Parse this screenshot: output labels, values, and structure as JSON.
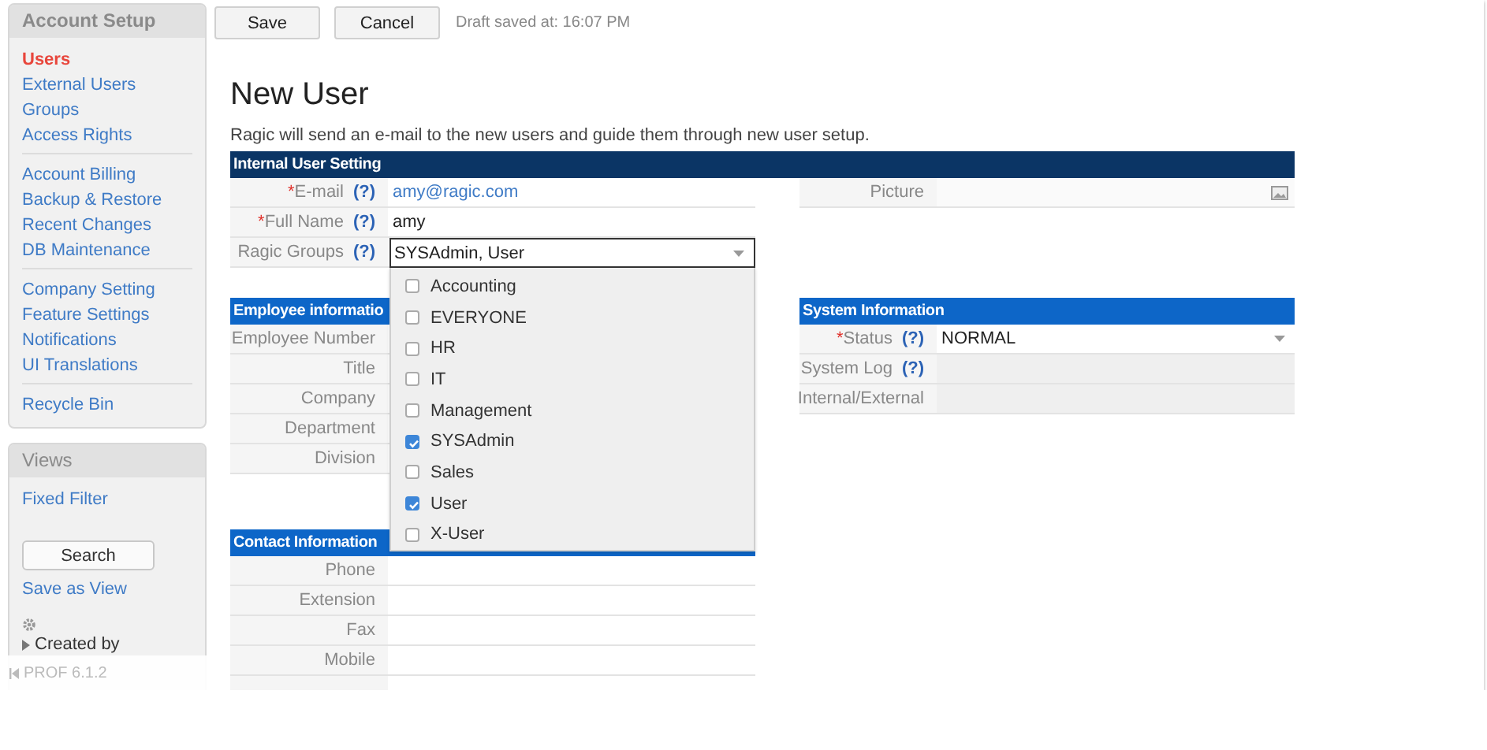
{
  "toolbar": {
    "buttons": [
      {
        "label": "Save"
      },
      {
        "label": "Cancel"
      }
    ],
    "draft_status": "Draft saved at: 16:07 PM"
  },
  "account_setup": {
    "title": "Account Setup",
    "groups": [
      {
        "items": [
          {
            "label": "Users",
            "selected": true
          },
          {
            "label": "External Users",
            "selected": false
          },
          {
            "label": "Groups",
            "selected": false
          },
          {
            "label": "Access Rights",
            "selected": false
          }
        ]
      },
      {
        "items": [
          {
            "label": "Account Billing",
            "selected": false
          },
          {
            "label": "Backup & Restore",
            "selected": false
          },
          {
            "label": "Recent Changes",
            "selected": false
          },
          {
            "label": "DB Maintenance",
            "selected": false
          }
        ]
      },
      {
        "items": [
          {
            "label": "Company Setting",
            "selected": false
          },
          {
            "label": "Feature Settings",
            "selected": false
          },
          {
            "label": "Notifications",
            "selected": false
          },
          {
            "label": "UI Translations",
            "selected": false
          }
        ]
      },
      {
        "items": [
          {
            "label": "Recycle Bin",
            "selected": false
          }
        ]
      }
    ]
  },
  "views": {
    "title": "Views",
    "items": [
      {
        "kind": "link",
        "label": "Fixed Filter"
      },
      {
        "kind": "button",
        "label": "Search"
      },
      {
        "kind": "link",
        "label": "Save as View"
      },
      {
        "kind": "gear"
      },
      {
        "kind": "tree",
        "label": "Created by",
        "expanded": false
      }
    ]
  },
  "footer": {
    "version": "PROF 6.1.2"
  },
  "page_title": "New User",
  "description": "Ragic will send an e-mail to the new users and guide them through new user setup.",
  "form": {
    "internal": {
      "title": "Internal User Setting",
      "left_fields": [
        {
          "label": "E-mail",
          "required_mark": "*",
          "help": "(?)",
          "kind": "link",
          "value": "amy@ragic.com"
        },
        {
          "label": "Full Name",
          "required_mark": "*",
          "help": "(?)",
          "kind": "text",
          "value": "amy"
        },
        {
          "label": "Ragic Groups",
          "help": "(?)",
          "kind": "multiselect",
          "value": "SYSAdmin, User",
          "expanded": true,
          "options": [
            {
              "label": "Accounting",
              "checked": false
            },
            {
              "label": "EVERYONE",
              "checked": false
            },
            {
              "label": "HR",
              "checked": false
            },
            {
              "label": "IT",
              "checked": false
            },
            {
              "label": "Management",
              "checked": false
            },
            {
              "label": "SYSAdmin",
              "checked": true
            },
            {
              "label": "Sales",
              "checked": false
            },
            {
              "label": "User",
              "checked": true
            },
            {
              "label": "X-User",
              "checked": false
            }
          ]
        }
      ],
      "right_fields": [
        {
          "label": "Picture",
          "kind": "image"
        }
      ]
    },
    "employee": {
      "title": "Employee informatio",
      "fields": [
        {
          "label": "Employee Number",
          "kind": "text"
        },
        {
          "label": "Title",
          "kind": "text"
        },
        {
          "label": "Company",
          "kind": "text"
        },
        {
          "label": "Department",
          "kind": "text"
        },
        {
          "label": "Division",
          "kind": "text"
        }
      ]
    },
    "system": {
      "title": "System Information",
      "fields": [
        {
          "label": "Status",
          "required_mark": "*",
          "help": "(?)",
          "kind": "select",
          "value": "NORMAL"
        },
        {
          "label": "System Log",
          "help": "(?)",
          "kind": "readonly"
        },
        {
          "label": "Internal/External",
          "kind": "readonly"
        }
      ]
    },
    "contact": {
      "title": "Contact Information",
      "fields": [
        {
          "label": "Phone",
          "kind": "text"
        },
        {
          "label": "Extension",
          "kind": "text"
        },
        {
          "label": "Fax",
          "kind": "text"
        },
        {
          "label": "Mobile",
          "kind": "text"
        },
        {
          "kind": "text"
        }
      ]
    }
  }
}
